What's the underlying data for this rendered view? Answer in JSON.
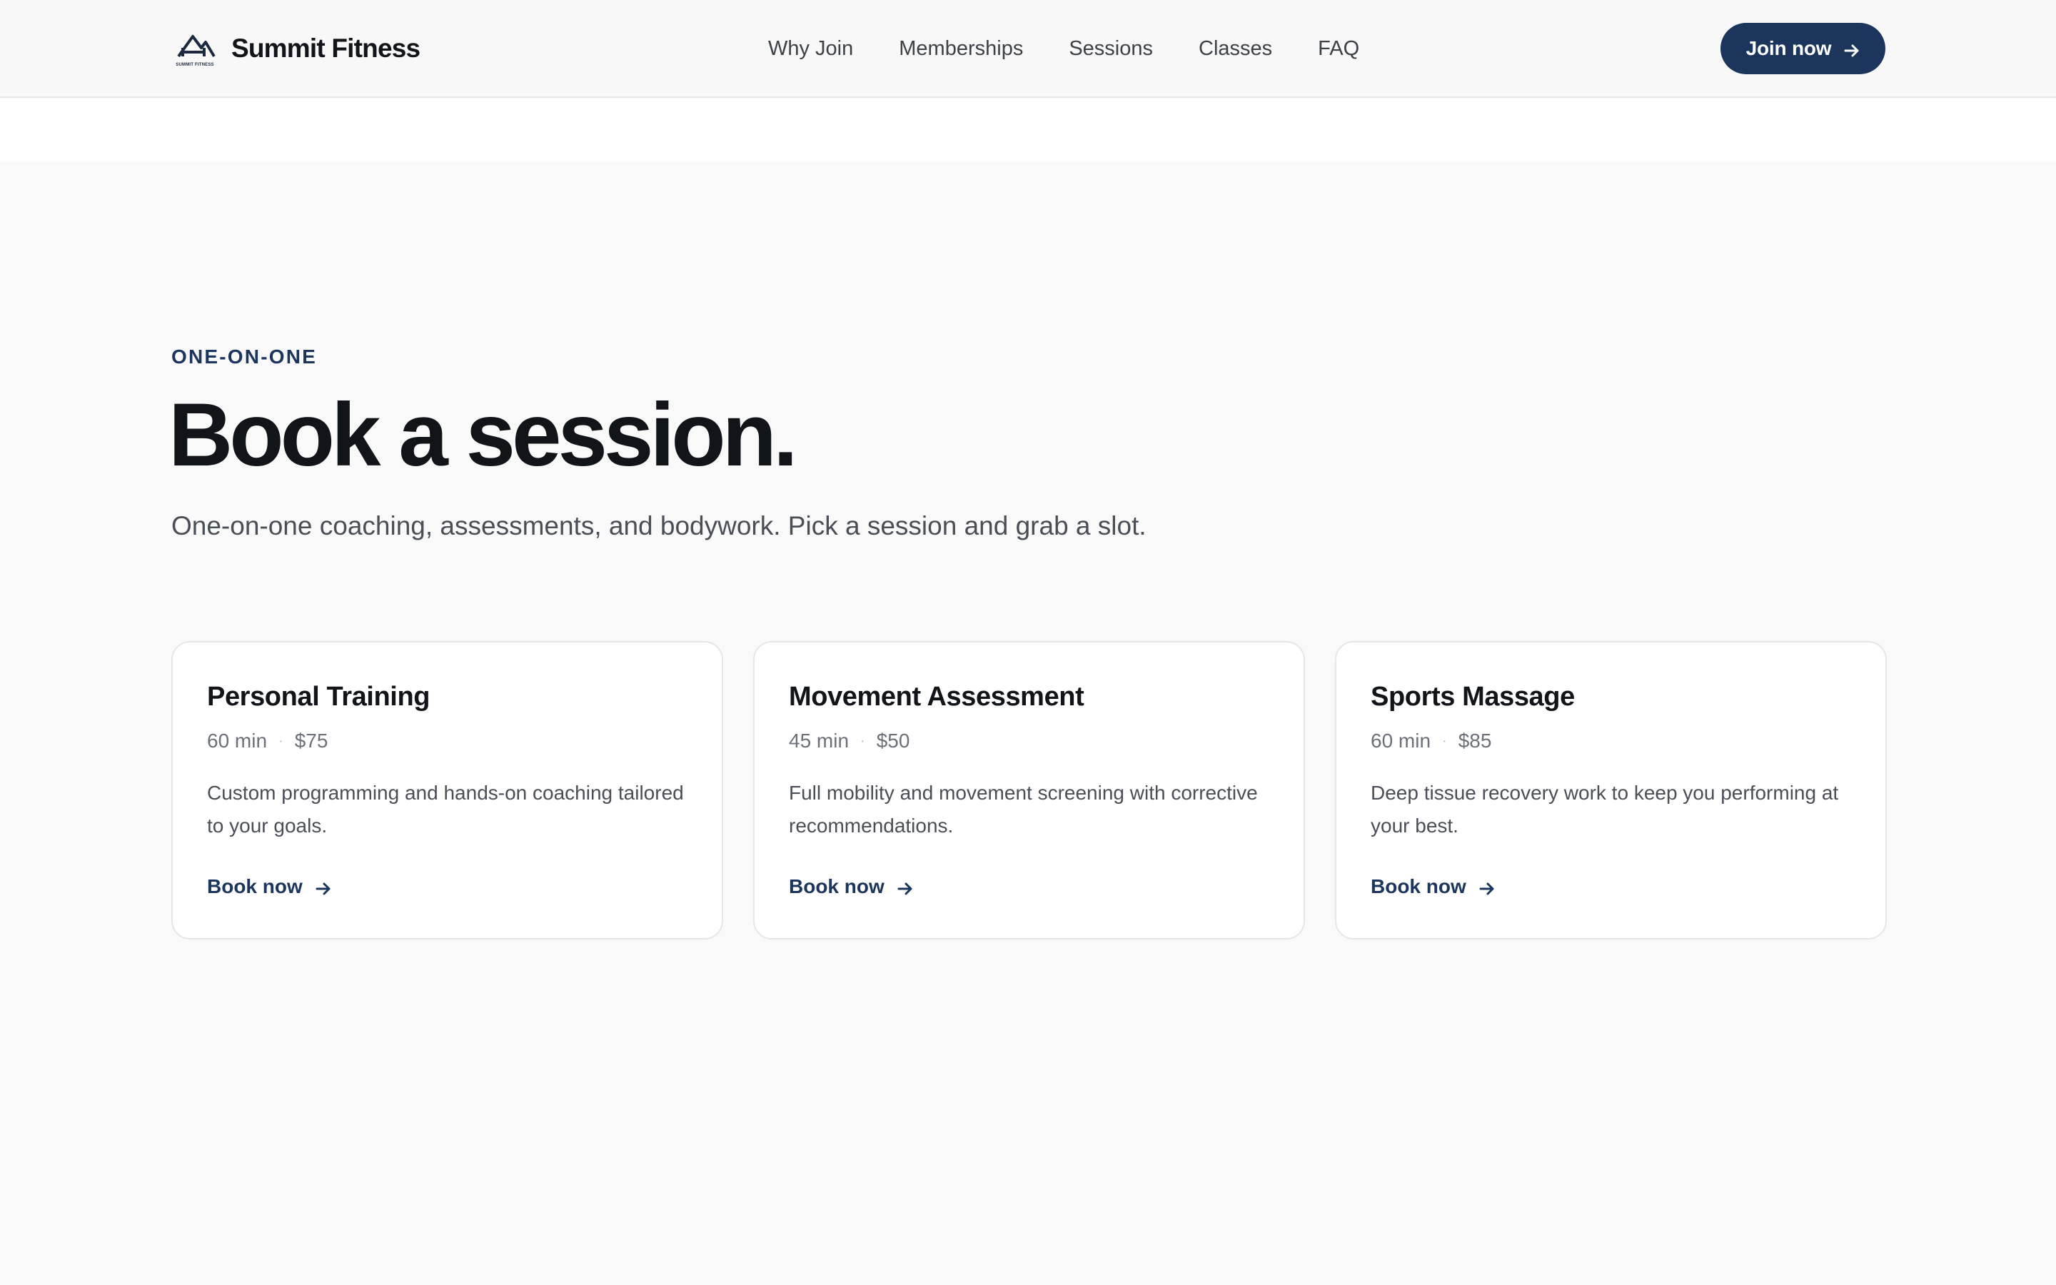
{
  "header": {
    "brand_name": "Summit Fitness",
    "logo_subtext": "SUMMIT FITNESS",
    "nav": [
      {
        "label": "Why Join"
      },
      {
        "label": "Memberships"
      },
      {
        "label": "Sessions"
      },
      {
        "label": "Classes"
      },
      {
        "label": "FAQ"
      }
    ],
    "cta_label": "Join now",
    "cta_icon": "arrow-right-icon"
  },
  "hero": {
    "eyebrow": "ONE-ON-ONE",
    "title": "Book a session.",
    "subtitle": "One-on-one coaching, assessments, and bodywork. Pick a session and grab a slot."
  },
  "sessions": [
    {
      "title": "Personal Training",
      "duration": "60 min",
      "separator": "·",
      "price": "$75",
      "description": "Custom programming and hands-on coaching tailored to your goals.",
      "link_label": "Book now"
    },
    {
      "title": "Movement Assessment",
      "duration": "45 min",
      "separator": "·",
      "price": "$50",
      "description": "Full mobility and movement screening with corrective recommendations.",
      "link_label": "Book now"
    },
    {
      "title": "Sports Massage",
      "duration": "60 min",
      "separator": "·",
      "price": "$85",
      "description": "Deep tissue recovery work to keep you performing at your best.",
      "link_label": "Book now"
    }
  ],
  "colors": {
    "accent": "#1c355c",
    "page_background": "#f9f9f9",
    "card_background": "#ffffff",
    "text_primary": "#111418",
    "text_secondary": "#4a4f57"
  }
}
